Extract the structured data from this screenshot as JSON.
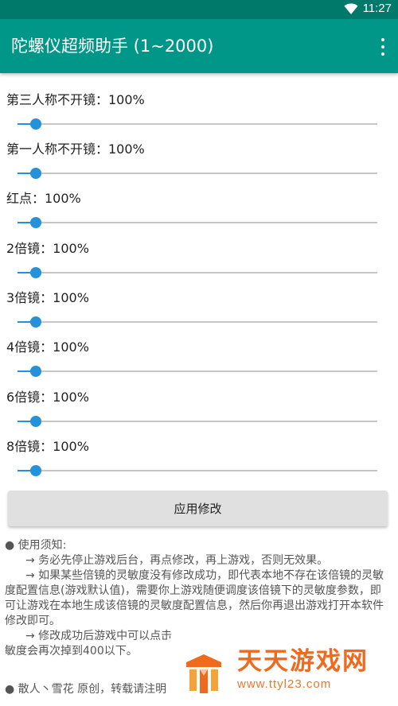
{
  "status_bar": {
    "time": "11:27",
    "wifi_icon": "wifi-icon"
  },
  "app_bar": {
    "title": "陀螺仪超频助手 (1~2000)",
    "menu_icon": "more-vert-icon",
    "color": "#009688"
  },
  "accent_color": "#2591d8",
  "settings": [
    {
      "label": "第三人称不开镜：100%",
      "value_fraction": 0.05
    },
    {
      "label": "第一人称不开镜：100%",
      "value_fraction": 0.05
    },
    {
      "label": "红点：100%",
      "value_fraction": 0.05
    },
    {
      "label": "2倍镜：100%",
      "value_fraction": 0.05
    },
    {
      "label": "3倍镜：100%",
      "value_fraction": 0.05
    },
    {
      "label": "4倍镜：100%",
      "value_fraction": 0.05
    },
    {
      "label": "6倍镜：100%",
      "value_fraction": 0.05
    },
    {
      "label": "8倍镜：100%",
      "value_fraction": 0.05
    }
  ],
  "apply_button": {
    "label": "应用修改"
  },
  "notes": {
    "heading": "● 使用须知:",
    "line1": "→ 务必先停止游戏后台，再点修改，再上游戏，否则无效果。",
    "line2": "→ 如果某些倍镜的灵敏度没有修改成功，即代表本地不存在该倍镜的灵敏度配置信息(游戏默认值)，需要你上游戏随便调度该倍镜下的灵敏度参数，即可让游戏在本地生成该倍镜的灵敏度配置信息，然后你再退出游戏打开本软件修改即可。",
    "line3": "→ 修改成功后游戏中可以点击",
    "line4": "敏度会再次掉到400以下。",
    "footer": "● 散人丶雪花 原创，转载请注明"
  },
  "watermark": {
    "brand": "天天游戏网",
    "url": "www.ttyl23.com",
    "logo_icon": "ttyl-logo-icon",
    "color": "#ee6a1f"
  }
}
